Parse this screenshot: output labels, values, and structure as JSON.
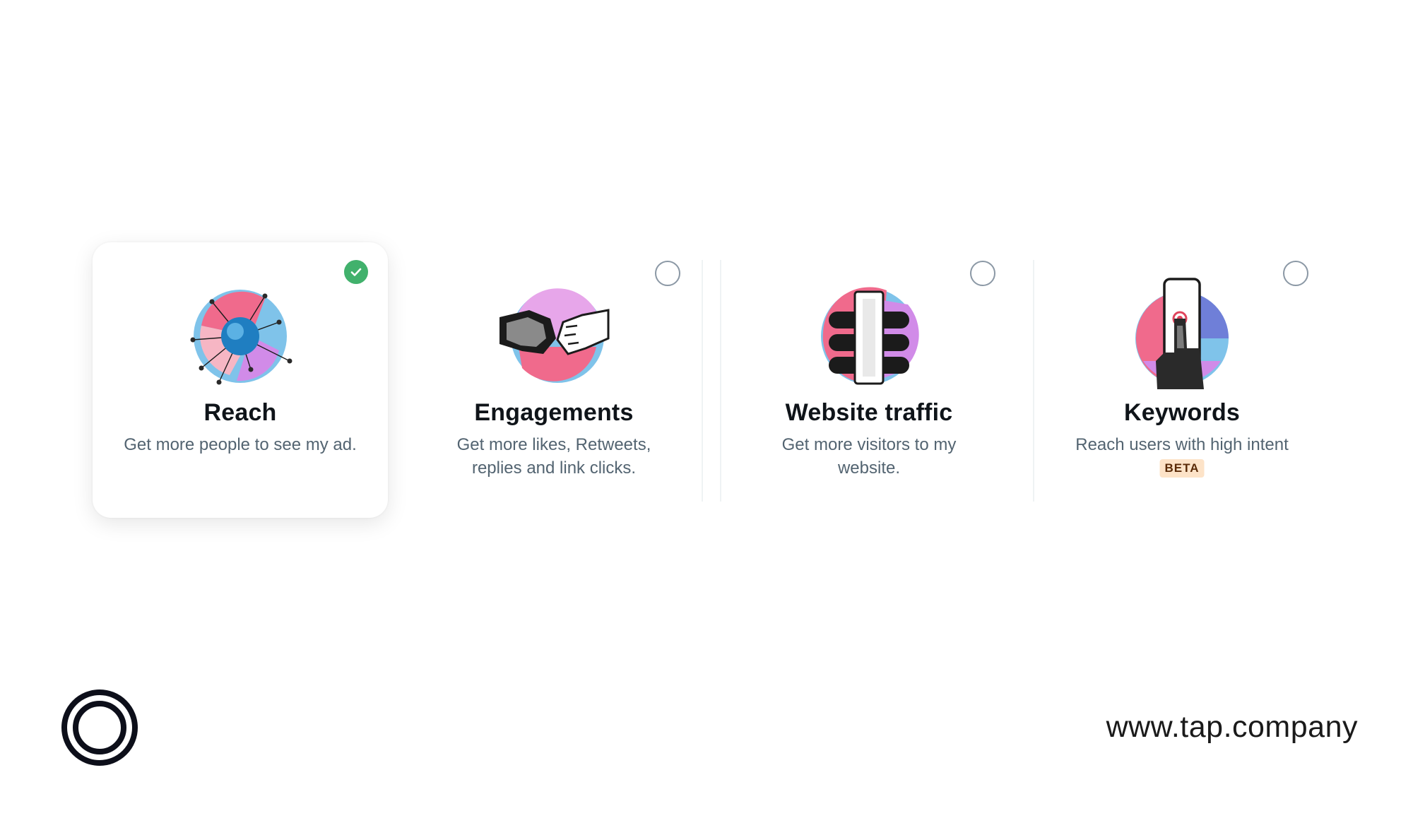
{
  "objectives": [
    {
      "title": "Reach",
      "description": "Get more people to see my ad.",
      "selected": true,
      "icon": "reach-network-globe-icon"
    },
    {
      "title": "Engagements",
      "description": "Get more likes, Retweets, replies and link clicks.",
      "selected": false,
      "icon": "fist-bump-icon"
    },
    {
      "title": "Website traffic",
      "description": "Get more visitors to my website.",
      "selected": false,
      "icon": "traffic-light-icon"
    },
    {
      "title": "Keywords",
      "description": "Reach users with high intent",
      "badge": "BETA",
      "selected": false,
      "icon": "finger-tap-phone-icon"
    }
  ],
  "footer": {
    "url": "www.tap.company",
    "logo_icon": "tap-ring-logo"
  },
  "colors": {
    "selected_check": "#41b16c",
    "radio_border": "#8b98a5",
    "title": "#0f1419",
    "description": "#536471",
    "beta_bg": "#fde3c8",
    "beta_text": "#5a2a07"
  }
}
